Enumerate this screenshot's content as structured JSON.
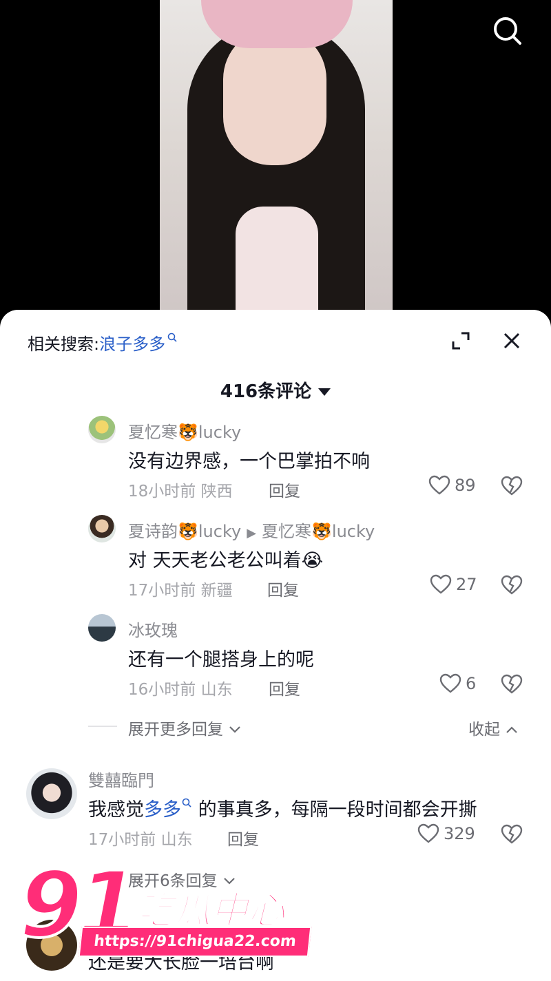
{
  "related_search": {
    "label": "相关搜索:",
    "keyword": "浪子多多"
  },
  "comment_count": "416条评论",
  "replies": [
    {
      "user": "夏忆寒🐯lucky",
      "text": "没有边界感，一个巴掌拍不响",
      "time": "18小时前",
      "location": "陕西",
      "reply": "回复",
      "likes": "89"
    },
    {
      "user": "夏诗韵🐯lucky",
      "reply_to": "夏忆寒🐯lucky",
      "text": "对 天天老公老公叫着😭",
      "time": "17小时前",
      "location": "新疆",
      "reply": "回复",
      "likes": "27"
    },
    {
      "user": "冰玫瑰",
      "text": "还有一个腿搭身上的呢",
      "time": "16小时前",
      "location": "山东",
      "reply": "回复",
      "likes": "6"
    }
  ],
  "expand_more_replies": "展开更多回复",
  "collapse": "收起",
  "main_comment": {
    "user": "雙囍臨門",
    "text_before": "我感觉",
    "keyword": "多多",
    "text_after": "的事真多，每隔一段时间都会开撕",
    "time": "17小时前",
    "location": "山东",
    "reply": "回复",
    "likes": "329"
  },
  "expand_replies": "展开6条回复",
  "partial_comment_text": "还是要大长脸一培台啊",
  "watermark": {
    "number": "91",
    "title": "吃瓜中心",
    "url": "https://91chigua22.com"
  },
  "colors": {
    "accent_blue": "#2a5fc8",
    "watermark_pink": "#ff2d78"
  }
}
